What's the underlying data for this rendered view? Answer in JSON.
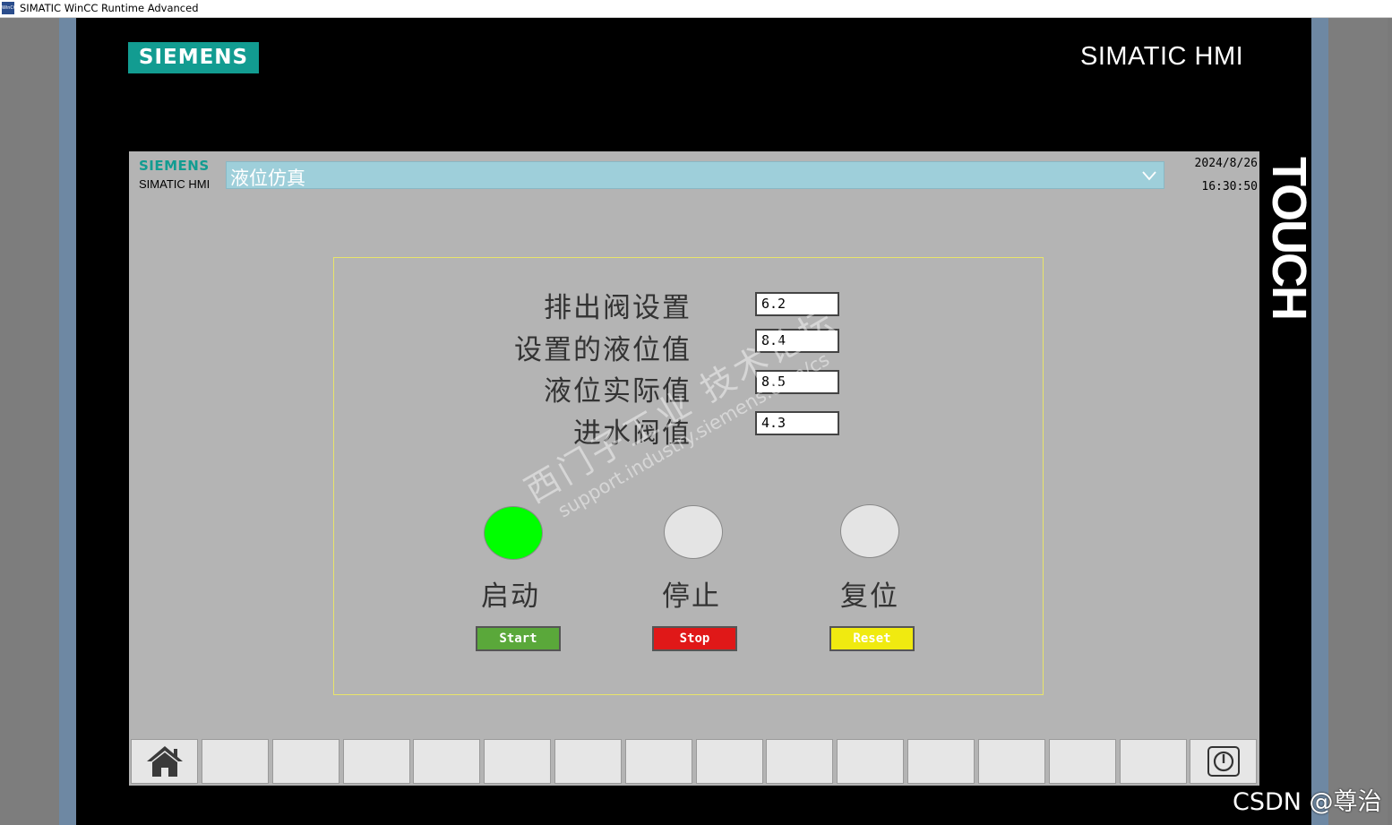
{
  "window": {
    "title": "SIMATIC WinCC Runtime Advanced",
    "app_icon_text": "WinCC"
  },
  "bezel": {
    "logo": "SIEMENS",
    "brand": "SIMATIC HMI",
    "touch": "TOUCH"
  },
  "screen_header": {
    "brand": "SIEMENS",
    "sub": "SIMATIC HMI",
    "screen_name": "液位仿真",
    "date": "2024/8/26",
    "time": "16:30:50"
  },
  "fields": [
    {
      "label": "排出阀设置",
      "value": "6.2"
    },
    {
      "label": "设置的液位值",
      "value": "8.4"
    },
    {
      "label": "液位实际值",
      "value": "8.5"
    },
    {
      "label": "进水阀值",
      "value": "4.3"
    }
  ],
  "lamps": [
    {
      "label": "启动",
      "state": "on",
      "color": "#00ff00"
    },
    {
      "label": "停止",
      "state": "off",
      "color": "#e4e4e4"
    },
    {
      "label": "复位",
      "state": "off",
      "color": "#e4e4e4"
    }
  ],
  "buttons": [
    {
      "label": "Start",
      "color": "#5aa83a"
    },
    {
      "label": "Stop",
      "color": "#e01818"
    },
    {
      "label": "Reset",
      "color": "#f0ea10"
    }
  ],
  "watermark": {
    "line1": "西门子工业 技术论坛",
    "line2": "support.industry.siemens.com/cs"
  },
  "function_keys": {
    "home_icon": "home-icon",
    "power_icon": "power-icon"
  },
  "colors": {
    "siemens_teal": "#129c91",
    "screen_bg": "#b4b4b4",
    "header_select": "#9ecfda"
  },
  "footer_watermark": "CSDN @尊治"
}
